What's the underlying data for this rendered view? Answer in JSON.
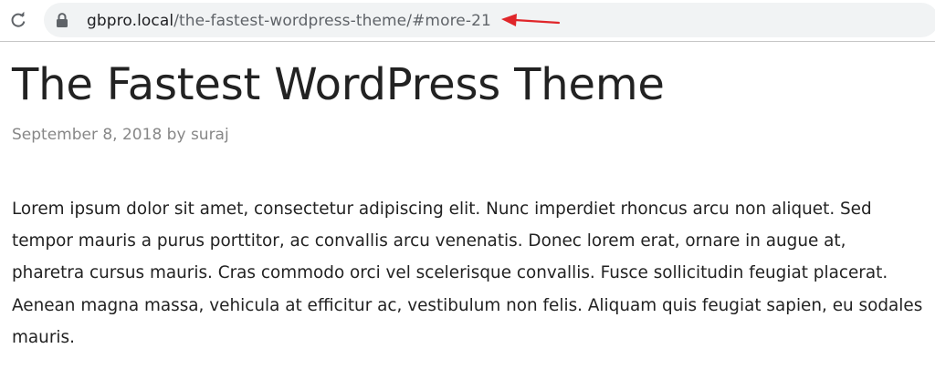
{
  "browser": {
    "reload_icon": "reload-icon",
    "lock_icon": "lock-icon",
    "url_host": "gbpro.local",
    "url_path": "/the-fastest-wordpress-theme/#more-21",
    "annotation_color": "#e0262a"
  },
  "post": {
    "title": "The Fastest WordPress Theme",
    "date": "September 8, 2018",
    "by": "by",
    "author": "suraj",
    "paragraph": "Lorem ipsum dolor sit amet, consectetur adipiscing elit. Nunc imperdiet rhoncus arcu non aliquet. Sed tempor mauris a purus porttitor, ac convallis arcu venenatis. Donec lorem erat, ornare in augue at, pharetra cursus mauris. Cras commodo orci vel scelerisque convallis. Fusce sollicitudin feugiat placerat. Aenean magna massa, vehicula at efficitur ac, vestibulum non felis. Aliquam quis feugiat sapien, eu sodales mauris."
  }
}
